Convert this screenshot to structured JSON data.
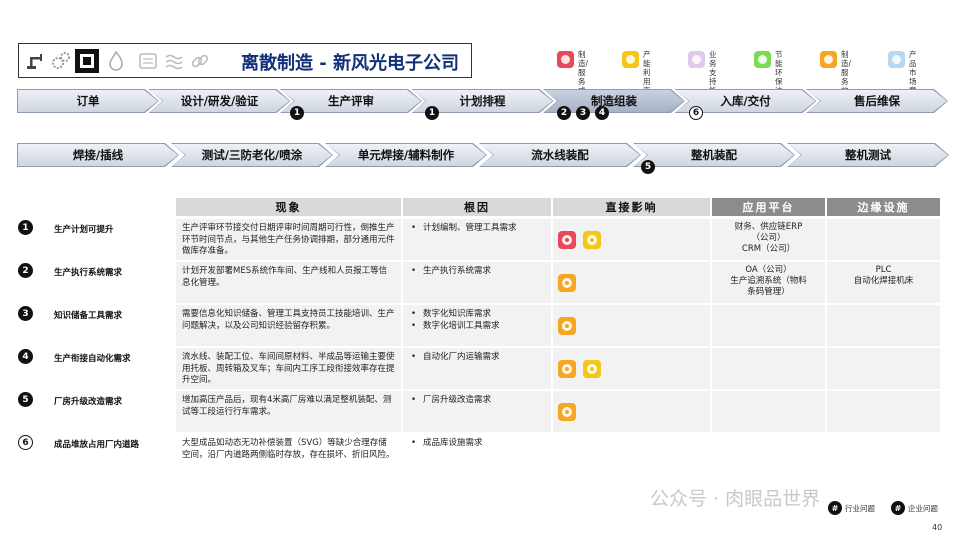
{
  "header": {
    "title": "离散制造 - 新风光电子公司"
  },
  "legend": [
    {
      "label": "制造/服务\n成本",
      "color": "#e8485a",
      "icon": "money-icon"
    },
    {
      "label": "产能\n利用率",
      "color": "#f5c518",
      "icon": "gauge-icon"
    },
    {
      "label": "业务支持\n能力",
      "color": "#e3c8ee",
      "icon": "gear-icon"
    },
    {
      "label": "节能环保\n达标",
      "color": "#7ed957",
      "icon": "leaf-icon"
    },
    {
      "label": "制造/服务\n效率",
      "color": "#f5a623",
      "icon": "bulb-icon"
    },
    {
      "label": "产品市场\n竞争力",
      "color": "#b7d7f2",
      "icon": "market-icon"
    }
  ],
  "process_row1": [
    "订单",
    "设计/研发/验证",
    "生产评审",
    "计划排程",
    "制造组装",
    "入库/交付",
    "售后维保"
  ],
  "process_row2": [
    "焊接/插线",
    "测试/三防老化/喷涂",
    "单元焊接/辅料制作",
    "流水线装配",
    "整机装配",
    "整机测试"
  ],
  "process_markers": {
    "m1": "1",
    "m2": "1",
    "m3": "2",
    "m4": "3",
    "m5": "4",
    "m6": "6",
    "m7": "5"
  },
  "table": {
    "headers": [
      "现象",
      "根因",
      "直接影响",
      "应用平台",
      "边缘设施"
    ],
    "rows": [
      {
        "num": "1",
        "label": "生产计划可提升",
        "phenomenon": "生产评审环节接交付日期评审时间周期可行性，倒推生产环节时间节点，与其他生产任务协调排期，部分通用元件做库存准备。",
        "root_cause": [
          "计划编制、管理工具需求"
        ],
        "platform": "财务、供应链ERP\n（公司）\nCRM（公司）",
        "edge": ""
      },
      {
        "num": "2",
        "label": "生产执行系统需求",
        "phenomenon": "计划开发部署MES系统作车间、生产线和人员报工等信息化管理。",
        "root_cause": [
          "生产执行系统需求"
        ],
        "platform": "OA（公司）\n生产追溯系统（物料\n条码管理）",
        "edge": "PLC\n自动化焊接机床"
      },
      {
        "num": "3",
        "label": "知识储备工具需求",
        "phenomenon": "需要信息化知识储备、管理工具支持员工技能培训、生产问题解决，以及公司知识经验留存积累。",
        "root_cause": [
          "数字化知识库需求",
          "数字化培训工具需求"
        ],
        "platform": "",
        "edge": ""
      },
      {
        "num": "4",
        "label": "生产衔接自动化需求",
        "phenomenon": "流水线、装配工位、车间间原材料、半成品等运输主要使用托板、周转箱及叉车；车间内工序工段衔接效率存在提升空间。",
        "root_cause": [
          "自动化厂内运输需求"
        ],
        "platform": "",
        "edge": ""
      },
      {
        "num": "5",
        "label": "厂房升级改造需求",
        "phenomenon": "增加高压产品后，现有4米高厂房难以满足整机装配、测试等工段运行行车需求。",
        "root_cause": [
          "厂房升级改造需求"
        ],
        "platform": "",
        "edge": ""
      },
      {
        "num": "6",
        "label": "成品堆放占用厂内道路",
        "phenomenon": "大型成品如动态无功补偿装置（SVG）等缺少合理存储空间，沿厂内道路两侧临时存放，存在损坏、折旧风险。",
        "root_cause": [
          "成品库设施需求"
        ],
        "platform": "",
        "edge": ""
      }
    ]
  },
  "footer": {
    "watermark": "公众号 · 肉眼品世界",
    "industry_tag": "行业问题",
    "company_tag": "企业问题",
    "tag_symbol": "#",
    "page": "40"
  }
}
